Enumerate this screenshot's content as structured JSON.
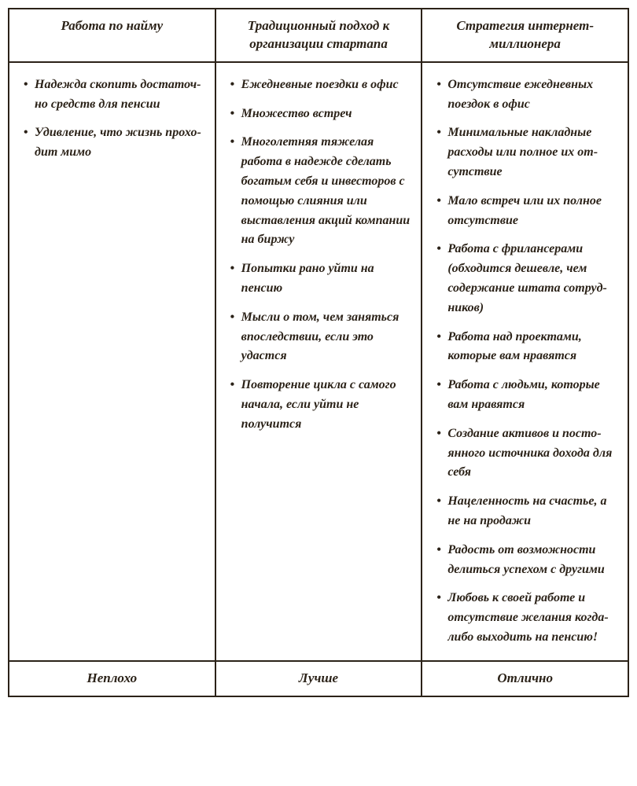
{
  "table": {
    "headers": [
      "Работа по найму",
      "Традиционный подход к организации стартапа",
      "Стратегия интернет-миллионера"
    ],
    "columns": [
      {
        "items": [
          "Надежда скопить достаточ­но средств для пенсии",
          "Удивление, что жизнь прохо­дит мимо"
        ]
      },
      {
        "items": [
          "Ежедневные поездки в офис",
          "Множество встреч",
          "Многолетняя тяжелая работа в надежде сделать богатым себя и инвесторов с помощью слияния или выставления ак­ций компании на биржу",
          "Попытки рано уйти на пенсию",
          "Мысли о том, чем заняться впоследствии, если это удастся",
          "Повторение цикла с самого на­чала, если уйти не получится"
        ]
      },
      {
        "items": [
          "Отсутствие ежедневных поездок в офис",
          "Минимальные накладные расходы или полное их от­сутствие",
          "Мало встреч или их пол­ное отсутствие",
          "Работа с фрилансерами (обходится дешевле, чем содержание штата сотруд­ников)",
          "Работа над проектами, которые вам нравятся",
          "Работа с людьми, которые вам нравятся",
          "Создание активов и посто­янного источника дохода для себя",
          "Нацеленность на счастье, а не на продажи",
          "Радость от возможности делиться успехом с дру­гими",
          "Любовь к своей работе и отсутствие желания когда-либо выходить на пенсию!"
        ]
      }
    ],
    "footers": [
      "Неплохо",
      "Лучше",
      "Отлично"
    ]
  }
}
